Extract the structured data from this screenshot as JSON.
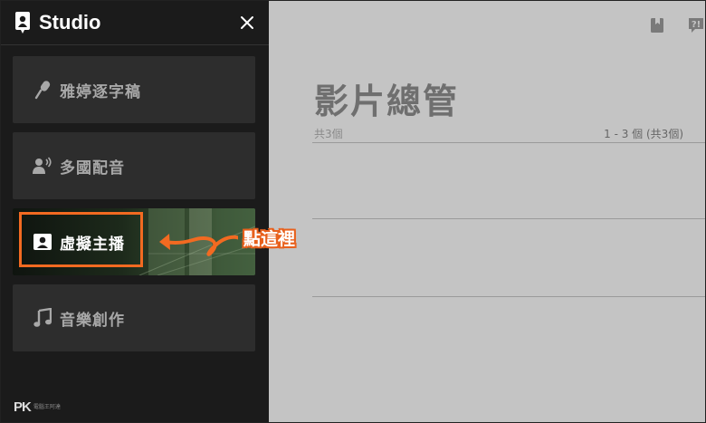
{
  "app": {
    "name": "Studio"
  },
  "sidebar": {
    "items": [
      {
        "label": "雅婷逐字稿",
        "icon": "microphone-icon"
      },
      {
        "label": "多國配音",
        "icon": "speaking-person-icon"
      },
      {
        "label": "虛擬主播",
        "icon": "person-badge-icon",
        "active": true
      },
      {
        "label": "音樂創作",
        "icon": "music-note-icon"
      }
    ],
    "close_icon": "close-icon"
  },
  "annotation": {
    "callout": "點這裡",
    "color": "#f26a21"
  },
  "main": {
    "title": "影片總管",
    "count_left": "共3個",
    "count_right": "1 - 3 個 (共3個)",
    "toolbar_icons": [
      "bookmark-icon",
      "help-icon"
    ]
  },
  "watermark": {
    "brand": "PK",
    "sub": "電腦王阿達"
  }
}
